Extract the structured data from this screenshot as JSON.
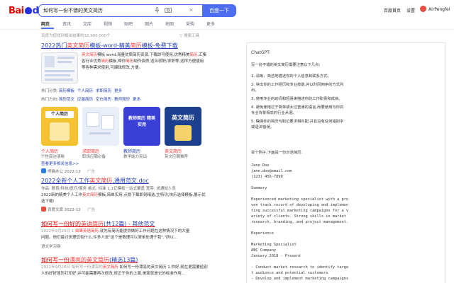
{
  "header": {
    "logo_bai": "Bai",
    "logo_du": "du",
    "logo_cn": "百度",
    "query": "如何写一份不错的英文简历",
    "search_button": "百度一下",
    "links": [
      "百度首页",
      "设置"
    ],
    "username": "AirPengfei"
  },
  "tabs": [
    "网页",
    "资讯",
    "文库",
    "视频",
    "贴吧",
    "图片",
    "地图",
    "采购",
    "更多"
  ],
  "result_count": "百度为您找到相关结果约32,900,000个",
  "tools_label": "搜索工具",
  "results": {
    "r1": {
      "title_pre": "2022热门",
      "title_em": "英文简历",
      "title_mid": "模板-word-精美",
      "title_em2": "简历",
      "title_post": "模板-免费下载",
      "lines": [
        [
          "",
          "英文简历",
          "模板 word,海量",
          "优质简历资源,下载即可使用,优秀精美",
          "简历",
          ",汇集"
        ],
        [
          "各行业优秀",
          "简历",
          "模板,帮你",
          "简历",
          "制作",
          "资质,适合就职/求职等,这样方便使用"
        ],
        [
          "等各种需求使用,可编辑修改,方便。",
          "",
          "",
          "",
          "",
          ""
        ]
      ],
      "hot_label": "热门分类:",
      "hot_items": [
        "简历模板",
        "个人简历",
        "求职简历",
        "更多"
      ],
      "hot_label2": "热门方向:",
      "hot_items2": [
        "简历范文",
        "应届简历",
        "空白简历",
        "教师简历",
        "更多"
      ],
      "cards": [
        {
          "label_em": "个人简历",
          "label": "",
          "sub": "个性简洁清晰"
        },
        {
          "label_em": "求职简历",
          "label": "",
          "sub": "职场应聘必备"
        },
        {
          "label_em": "",
          "label": "教师简历",
          "sub": "教学能力突出"
        },
        {
          "label_em": "英文简历",
          "label": "",
          "sub": "英文应聘推荐"
        }
      ],
      "card_texts": [
        "个人简历",
        "",
        "教师简历",
        "英文简历"
      ],
      "card_sub_texts": [
        "",
        "",
        "教师简历 精美实用",
        ""
      ],
      "more_link": "查看更多相关信息>>",
      "source": "熊猫办公 2022-12",
      "ad": "广告"
    },
    "r2": {
      "title_pre": "2022全新个人工作",
      "title_em": "英文简历",
      "title_post": ",通用范文.doc",
      "line1_pre": "作品: 教育/科技/医疗/服务   格式: 标准 1,1亿模板一站式覆盖   宽带: 求通知人员",
      "line2_pre": "2022新的精美个人工作",
      "line2_em": "英文简历",
      "line2_post": "模板,简单实用,点划下载即刻精选,主特功,快乐选择模板,展示优",
      "line3": "选下载!",
      "source": "百度文库 2022-12",
      "ad": "广告"
    },
    "r3": {
      "title_pre": "如何写一份好的",
      "title_em": "英语简历",
      "title_post": "(共12篇) - 其他范文",
      "line1_pre": "2022年9月25日 1.",
      "line1_em": "如果英语简历",
      "line1_post": ",就先有简历能提供做好工作问题在这种情况下的大量",
      "line2": "问题。他们最讨厌理您有什么,许多人说\"这个是数理可以简单处理于我\",\"所以...",
      "source": "语文学习网"
    },
    "r4": {
      "title_pre": "如何写一份",
      "title_em": "漂亮的英文简历",
      "title_post": "(精选13篇)",
      "line1_pre": "2022年9月26日 如何写一份漂亮的",
      "line1_em": "英文简历",
      "line1_post": " 如何写一份漂亮的英文简历 1.你好,现在更需要给别",
      "line2": "人的好好简历打印好,并可能需要再次修改,修正于你的上面,美面就是它的标准作用..."
    }
  },
  "gpt": {
    "title": "ChatGPT:",
    "intro": "写一份不错的英文简历需要注意以下几点:",
    "points": [
      "1. 清晰、简洁地描述你的个人信息和联系方式。",
      "2. 突出你的工作经历和专业技能,并以时间倒序的方式列",
      "出。",
      "3. 使用专业的动词和短语来描述你的工作职责和成就。",
      "4. 避免使用过于简单或太过普通的语言,而要使用与你的",
      "专业背景相关的行业术语。",
      "5. 确保你的简历与职位要求相匹配,并且没有任何错别字",
      "或语法错误。"
    ],
    "example_intro": "举个例子,下面是一份示范简历:",
    "resume_lines": [
      "Jane Doe",
      "jane.doe@email.com",
      "(123) 456-7890",
      "",
      "Summary",
      "",
      "Experienced marketing specialist with a pro",
      "ven track record of developing and implemen",
      "ting successful marketing campaigns for a v",
      "ariety of clients. Strong skills in market",
      "research, branding, and project management.",
      "",
      "Experience",
      "",
      "Marketing Specialist",
      "ABC Company",
      "January 2018 - Present",
      "",
      "- Conduct market research to identify targe",
      "t audience and potential customers",
      "- Develop and implement marketing campaigns"
    ]
  }
}
